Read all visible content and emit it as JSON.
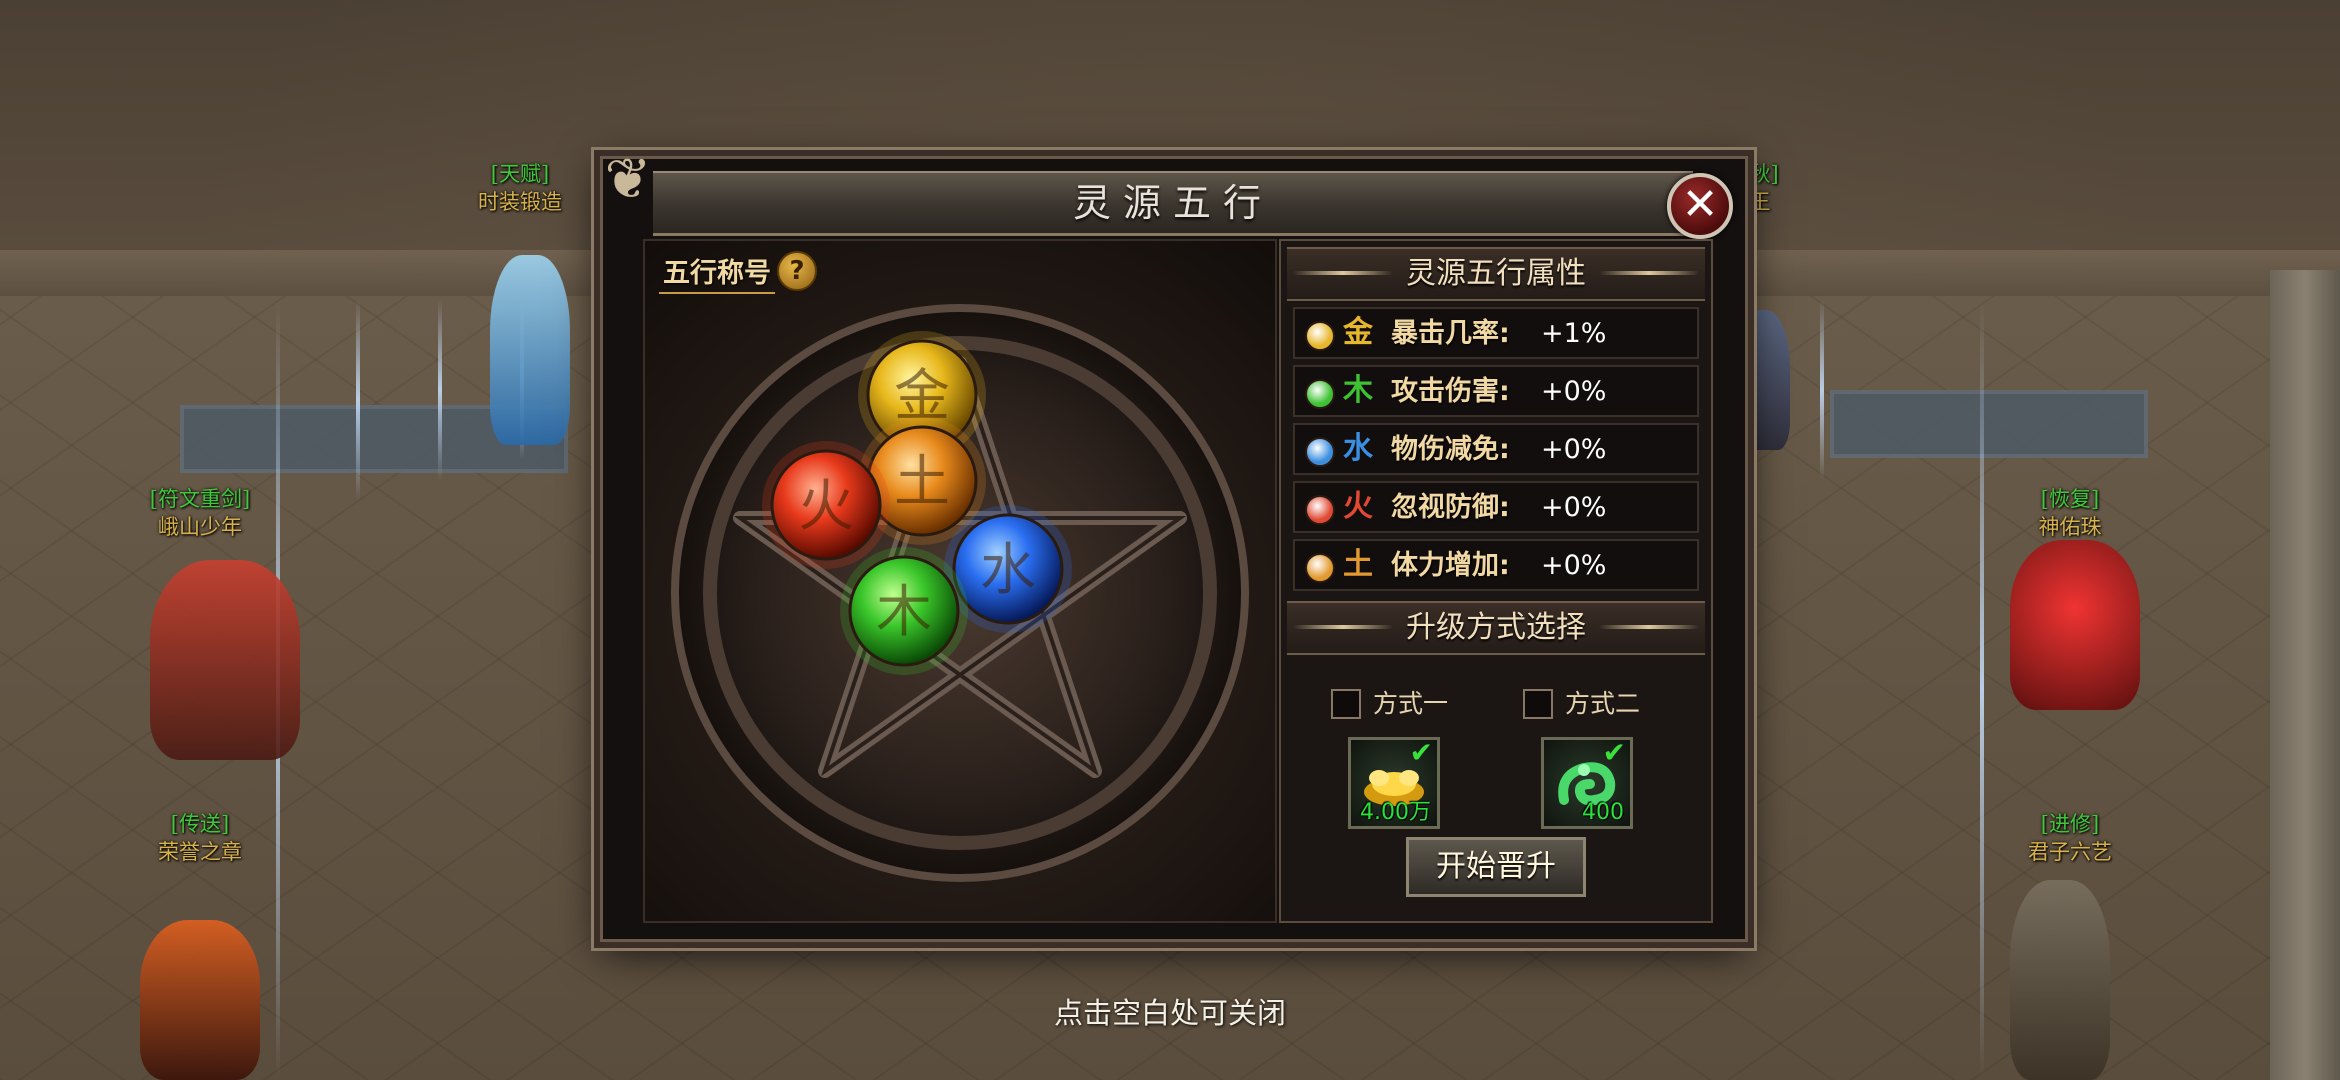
{
  "dialog": {
    "title": "灵源五行",
    "wuxing_title": "五行称号",
    "help_symbol": "?",
    "close_symbol": "✕",
    "orbs": [
      {
        "name": "metal",
        "glyph": "金",
        "color": "#e8b81c"
      },
      {
        "name": "earth",
        "glyph": "土",
        "color": "#e88a1c"
      },
      {
        "name": "fire",
        "glyph": "火",
        "color": "#e83a1c"
      },
      {
        "name": "water",
        "glyph": "水",
        "color": "#2a6ef0"
      },
      {
        "name": "wood",
        "glyph": "木",
        "color": "#3ac62a"
      }
    ],
    "attributes_header": "灵源五行属性",
    "attributes": [
      {
        "glyph": "金",
        "label": "暴击几率:",
        "value": "+1%",
        "color": "#e6b72c"
      },
      {
        "glyph": "木",
        "label": "攻击伤害:",
        "value": "+0%",
        "color": "#3ec233"
      },
      {
        "glyph": "水",
        "label": "物伤减免:",
        "value": "+0%",
        "color": "#3b8fe0"
      },
      {
        "glyph": "火",
        "label": "忽视防御:",
        "value": "+0%",
        "color": "#e04a35"
      },
      {
        "glyph": "土",
        "label": "体力增加:",
        "value": "+0%",
        "color": "#e29a30"
      }
    ],
    "upgrade_header": "升级方式选择",
    "options": [
      {
        "label": "方式一",
        "item_icon": "gold-ingot-icon",
        "count": "4.00万"
      },
      {
        "label": "方式二",
        "item_icon": "jade-dragon-icon",
        "count": "400"
      }
    ],
    "start_button": "开始晋升"
  },
  "hint": "点击空白处可关闭",
  "npcs": [
    {
      "title": "[天赋]",
      "name": "时装锻造"
    },
    {
      "title": "[符文重剑]",
      "name": "峨山少年"
    },
    {
      "title": "[传送]",
      "name": "荣誉之章"
    },
    {
      "title": "[秋]",
      "name": "王"
    },
    {
      "title": "[恢复]",
      "name": "神佑珠"
    },
    {
      "title": "[进修]",
      "name": "君子六艺"
    }
  ]
}
